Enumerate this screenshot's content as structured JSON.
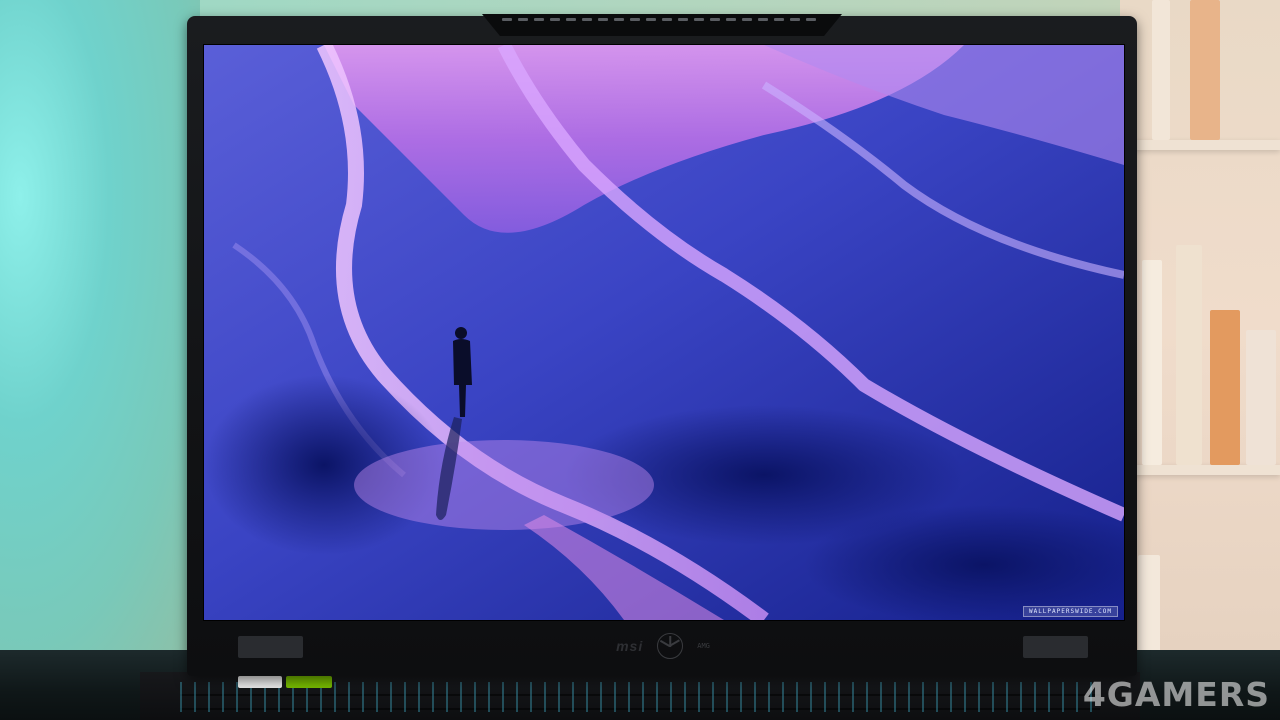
{
  "scene": {
    "description_colors": {
      "wall_left": "#7fd6d2",
      "screen_purple": "#c36bd9",
      "screen_blue": "#1e2fa8"
    }
  },
  "laptop": {
    "brand_logo": "msi",
    "emblem_icon": "mercedes-star-icon",
    "emblem_text": "AMG"
  },
  "screen": {
    "watermark": "WALLPAPERSWIDE.COM"
  },
  "photo_watermark": "4GAMERS"
}
